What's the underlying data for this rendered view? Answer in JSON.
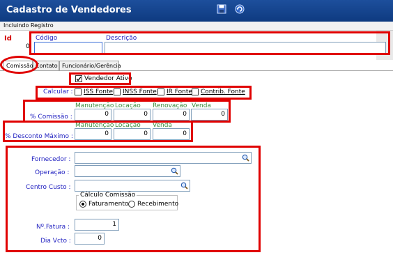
{
  "window": {
    "title": "Cadastro de Vendedores",
    "status": "Incluindo Registro"
  },
  "toolbar": {
    "icons": [
      "save-icon",
      "refresh-icon"
    ]
  },
  "header": {
    "id_label": "Id",
    "id_value": "0",
    "codigo_label": "Código",
    "codigo_value": "",
    "descricao_label": "Descrição",
    "descricao_value": ""
  },
  "tabs": [
    {
      "label": "Comissão",
      "active": true
    },
    {
      "label": "Contato",
      "active": false
    },
    {
      "label": "Funcionário/Gerência",
      "active": false
    }
  ],
  "vendedor_ativo": {
    "label": "Vendedor Ativo",
    "checked": true
  },
  "calcular": {
    "label": "Calcular :",
    "options": [
      {
        "label": "ISS Fonte",
        "checked": false
      },
      {
        "label": "INSS Fonte",
        "checked": false
      },
      {
        "label": "IR Fonte",
        "checked": false
      },
      {
        "label": "Contrib. Fonte",
        "checked": false
      }
    ]
  },
  "comissao": {
    "label": "% Comissão :",
    "columns": [
      "Manutenção",
      "Locação",
      "Renovação",
      "Venda"
    ],
    "values": [
      "0",
      "0",
      "0",
      "0"
    ]
  },
  "desconto": {
    "label": "% Desconto Máximo :",
    "columns": [
      "Manutenção",
      "Locação",
      "Venda"
    ],
    "values": [
      "0",
      "0",
      "0"
    ]
  },
  "fornecedor": {
    "label": "Fornecedor :",
    "value": ""
  },
  "operacao": {
    "label": "Operação :",
    "value": ""
  },
  "centro_custo": {
    "label": "Centro Custo :",
    "value": ""
  },
  "calculo_comissao": {
    "title": "Cálculo Comissão",
    "options": [
      {
        "label": "Faturamento",
        "selected": true
      },
      {
        "label": "Recebimento",
        "selected": false
      }
    ]
  },
  "fatura": {
    "label": "Nº.Fatura :",
    "value": "1"
  },
  "dia_vcto": {
    "label": "Dia Vcto :",
    "value": "0"
  },
  "colors": {
    "title_bar": "#1d4f9c",
    "annotation_red": "#e00000",
    "label_blue": "#2020c0",
    "label_green": "#3c8c3c",
    "label_red": "#d40000"
  }
}
